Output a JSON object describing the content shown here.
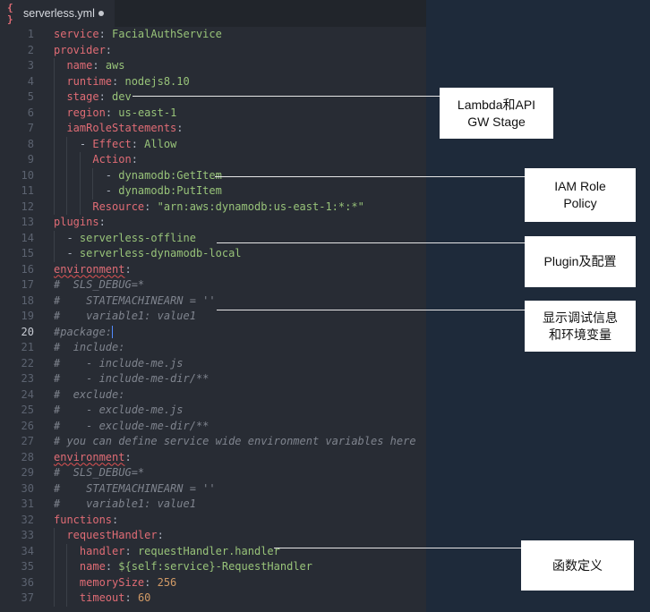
{
  "tab": {
    "icon": "{ }",
    "filename": "serverless.yml",
    "icon_name": "json-braces-icon"
  },
  "lines": [
    {
      "n": "1",
      "i": 0,
      "parts": [
        {
          "c": "k",
          "t": "service"
        },
        {
          "c": "p",
          "t": ": "
        },
        {
          "c": "s",
          "t": "FacialAuthService"
        }
      ]
    },
    {
      "n": "2",
      "i": 0,
      "parts": [
        {
          "c": "k",
          "t": "provider"
        },
        {
          "c": "p",
          "t": ":"
        }
      ]
    },
    {
      "n": "3",
      "i": 1,
      "parts": [
        {
          "c": "p",
          "t": "  "
        },
        {
          "c": "k",
          "t": "name"
        },
        {
          "c": "p",
          "t": ": "
        },
        {
          "c": "s",
          "t": "aws"
        }
      ]
    },
    {
      "n": "4",
      "i": 1,
      "parts": [
        {
          "c": "p",
          "t": "  "
        },
        {
          "c": "k",
          "t": "runtime"
        },
        {
          "c": "p",
          "t": ": "
        },
        {
          "c": "s",
          "t": "nodejs8.10"
        }
      ]
    },
    {
      "n": "5",
      "i": 1,
      "parts": [
        {
          "c": "p",
          "t": "  "
        },
        {
          "c": "k",
          "t": "stage"
        },
        {
          "c": "p",
          "t": ": "
        },
        {
          "c": "s",
          "t": "dev"
        }
      ]
    },
    {
      "n": "6",
      "i": 1,
      "parts": [
        {
          "c": "p",
          "t": "  "
        },
        {
          "c": "k",
          "t": "region"
        },
        {
          "c": "p",
          "t": ": "
        },
        {
          "c": "s",
          "t": "us-east-1"
        }
      ]
    },
    {
      "n": "7",
      "i": 1,
      "parts": [
        {
          "c": "p",
          "t": "  "
        },
        {
          "c": "k",
          "t": "iamRoleStatements"
        },
        {
          "c": "p",
          "t": ":"
        }
      ]
    },
    {
      "n": "8",
      "i": 2,
      "parts": [
        {
          "c": "p",
          "t": "    - "
        },
        {
          "c": "k",
          "t": "Effect"
        },
        {
          "c": "p",
          "t": ": "
        },
        {
          "c": "s",
          "t": "Allow"
        }
      ]
    },
    {
      "n": "9",
      "i": 3,
      "parts": [
        {
          "c": "p",
          "t": "      "
        },
        {
          "c": "k",
          "t": "Action"
        },
        {
          "c": "p",
          "t": ":"
        }
      ]
    },
    {
      "n": "10",
      "i": 4,
      "parts": [
        {
          "c": "p",
          "t": "        - "
        },
        {
          "c": "s",
          "t": "dynamodb:GetItem"
        }
      ]
    },
    {
      "n": "11",
      "i": 4,
      "parts": [
        {
          "c": "p",
          "t": "        - "
        },
        {
          "c": "s",
          "t": "dynamodb:PutItem"
        }
      ]
    },
    {
      "n": "12",
      "i": 3,
      "parts": [
        {
          "c": "p",
          "t": "      "
        },
        {
          "c": "k",
          "t": "Resource"
        },
        {
          "c": "p",
          "t": ": "
        },
        {
          "c": "s",
          "t": "\"arn:aws:dynamodb:us-east-1:*:*\""
        }
      ]
    },
    {
      "n": "13",
      "i": 0,
      "parts": [
        {
          "c": "k",
          "t": "plugins"
        },
        {
          "c": "p",
          "t": ":"
        }
      ]
    },
    {
      "n": "14",
      "i": 1,
      "parts": [
        {
          "c": "p",
          "t": "  - "
        },
        {
          "c": "s",
          "t": "serverless-offline"
        }
      ]
    },
    {
      "n": "15",
      "i": 1,
      "parts": [
        {
          "c": "p",
          "t": "  - "
        },
        {
          "c": "s",
          "t": "serverless-dynamodb-local"
        }
      ]
    },
    {
      "n": "16",
      "i": 0,
      "parts": [
        {
          "c": "k squig",
          "t": "environment"
        },
        {
          "c": "p",
          "t": ":"
        }
      ]
    },
    {
      "n": "17",
      "i": 0,
      "parts": [
        {
          "c": "c",
          "t": "#  SLS_DEBUG=*"
        }
      ]
    },
    {
      "n": "18",
      "i": 0,
      "parts": [
        {
          "c": "c",
          "t": "#    STATEMACHINEARN = ''"
        }
      ]
    },
    {
      "n": "19",
      "i": 0,
      "parts": [
        {
          "c": "c",
          "t": "#    variable1: value1"
        }
      ]
    },
    {
      "n": "20",
      "i": 0,
      "active": true,
      "parts": [
        {
          "c": "c",
          "t": "#package:"
        },
        {
          "c": "cursor",
          "t": ""
        }
      ]
    },
    {
      "n": "21",
      "i": 0,
      "parts": [
        {
          "c": "c",
          "t": "#  include:"
        }
      ]
    },
    {
      "n": "22",
      "i": 0,
      "parts": [
        {
          "c": "c",
          "t": "#    - include-me.js"
        }
      ]
    },
    {
      "n": "23",
      "i": 0,
      "parts": [
        {
          "c": "c",
          "t": "#    - include-me-dir/**"
        }
      ]
    },
    {
      "n": "24",
      "i": 0,
      "parts": [
        {
          "c": "c",
          "t": "#  exclude:"
        }
      ]
    },
    {
      "n": "25",
      "i": 0,
      "parts": [
        {
          "c": "c",
          "t": "#    - exclude-me.js"
        }
      ]
    },
    {
      "n": "26",
      "i": 0,
      "parts": [
        {
          "c": "c",
          "t": "#    - exclude-me-dir/**"
        }
      ]
    },
    {
      "n": "27",
      "i": 0,
      "parts": [
        {
          "c": "c",
          "t": "# you can define service wide environment variables here"
        }
      ]
    },
    {
      "n": "28",
      "i": 0,
      "parts": [
        {
          "c": "k squig",
          "t": "environment"
        },
        {
          "c": "p",
          "t": ":"
        }
      ]
    },
    {
      "n": "29",
      "i": 0,
      "parts": [
        {
          "c": "c",
          "t": "#  SLS_DEBUG=*"
        }
      ]
    },
    {
      "n": "30",
      "i": 0,
      "parts": [
        {
          "c": "c",
          "t": "#    STATEMACHINEARN = ''"
        }
      ]
    },
    {
      "n": "31",
      "i": 0,
      "parts": [
        {
          "c": "c",
          "t": "#    variable1: value1"
        }
      ]
    },
    {
      "n": "32",
      "i": 0,
      "parts": [
        {
          "c": "k",
          "t": "functions"
        },
        {
          "c": "p",
          "t": ":"
        }
      ]
    },
    {
      "n": "33",
      "i": 1,
      "parts": [
        {
          "c": "p",
          "t": "  "
        },
        {
          "c": "k",
          "t": "requestHandler"
        },
        {
          "c": "p",
          "t": ":"
        }
      ]
    },
    {
      "n": "34",
      "i": 2,
      "parts": [
        {
          "c": "p",
          "t": "    "
        },
        {
          "c": "k",
          "t": "handler"
        },
        {
          "c": "p",
          "t": ": "
        },
        {
          "c": "s",
          "t": "requestHandler.handler"
        }
      ]
    },
    {
      "n": "35",
      "i": 2,
      "parts": [
        {
          "c": "p",
          "t": "    "
        },
        {
          "c": "k",
          "t": "name"
        },
        {
          "c": "p",
          "t": ": "
        },
        {
          "c": "s",
          "t": "${self:service}-RequestHandler"
        }
      ]
    },
    {
      "n": "36",
      "i": 2,
      "parts": [
        {
          "c": "p",
          "t": "    "
        },
        {
          "c": "k",
          "t": "memorySize"
        },
        {
          "c": "p",
          "t": ": "
        },
        {
          "c": "n",
          "t": "256"
        }
      ]
    },
    {
      "n": "37",
      "i": 2,
      "parts": [
        {
          "c": "p",
          "t": "    "
        },
        {
          "c": "k",
          "t": "timeout"
        },
        {
          "c": "p",
          "t": ": "
        },
        {
          "c": "n",
          "t": "60"
        }
      ]
    }
  ],
  "annotations": [
    {
      "id": "stage",
      "text": "Lambda和API\nGW Stage"
    },
    {
      "id": "iam",
      "text": "IAM Role\nPolicy"
    },
    {
      "id": "plugin",
      "text": "Plugin及配置"
    },
    {
      "id": "debug",
      "text": "显示调试信息\n和环境变量"
    },
    {
      "id": "function",
      "text": "函数定义"
    }
  ],
  "colors": {
    "editor_bg": "#282c34",
    "key": "#e06c75",
    "string": "#98c379",
    "number": "#d19a66",
    "comment": "#7f848e",
    "outer_bg": "#1e2a3a"
  }
}
